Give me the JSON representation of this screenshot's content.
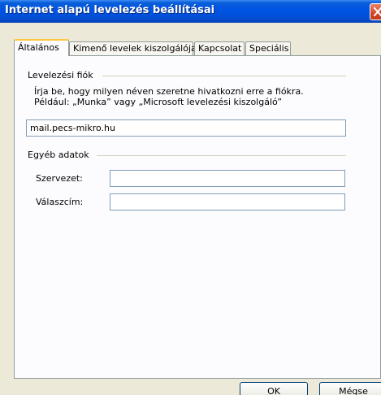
{
  "window": {
    "title": "Internet alapú levelezés beállításai",
    "close_glyph": "close-icon"
  },
  "tabs": [
    {
      "label": "Általános",
      "active": true
    },
    {
      "label": "Kimenő levelek kiszolgálója",
      "active": false
    },
    {
      "label": "Kapcsolat",
      "active": false
    },
    {
      "label": "Speciális",
      "active": false
    }
  ],
  "general": {
    "account_group": {
      "label": "Levelezési fiók",
      "description_line1": "Írja be, hogy milyen néven szeretne hivatkozni erre a fiókra.",
      "description_line2": "Például: „Munka” vagy „Microsoft levelezési kiszolgáló”",
      "account_name_value": "mail.pecs-mikro.hu"
    },
    "other_group": {
      "label": "Egyéb adatok",
      "organization_label": "Szervezet:",
      "organization_value": "",
      "reply_label": "Válaszcím:",
      "reply_value": ""
    }
  },
  "buttons": {
    "ok": "OK",
    "cancel": "Mégse"
  },
  "colors": {
    "titlebar": "#0054e3",
    "dialog_bg": "#ece9d8",
    "active_tab_accent": "#ffc83c",
    "input_border": "#7f9db9"
  }
}
